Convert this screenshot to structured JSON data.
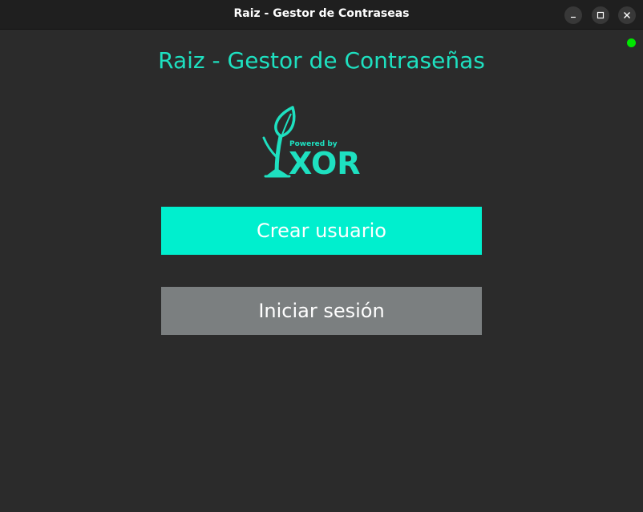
{
  "window": {
    "title": "Raiz - Gestor de Contraseas",
    "controls": {
      "minimize_icon": "minimize-icon",
      "maximize_icon": "maximize-icon",
      "close_icon": "close-icon"
    }
  },
  "status": {
    "indicator_color": "#00e600"
  },
  "app": {
    "heading": "Raiz - Gestor de Contraseñas",
    "accent_color": "#1ee0c0"
  },
  "logo": {
    "icon": "sprout-icon",
    "powered_by": "Powered by",
    "brand": "XOR"
  },
  "actions": {
    "create_user_label": "Crear usuario",
    "create_user_color": "#00efce",
    "login_label": "Iniciar sesión",
    "login_color": "#7b7f80"
  }
}
